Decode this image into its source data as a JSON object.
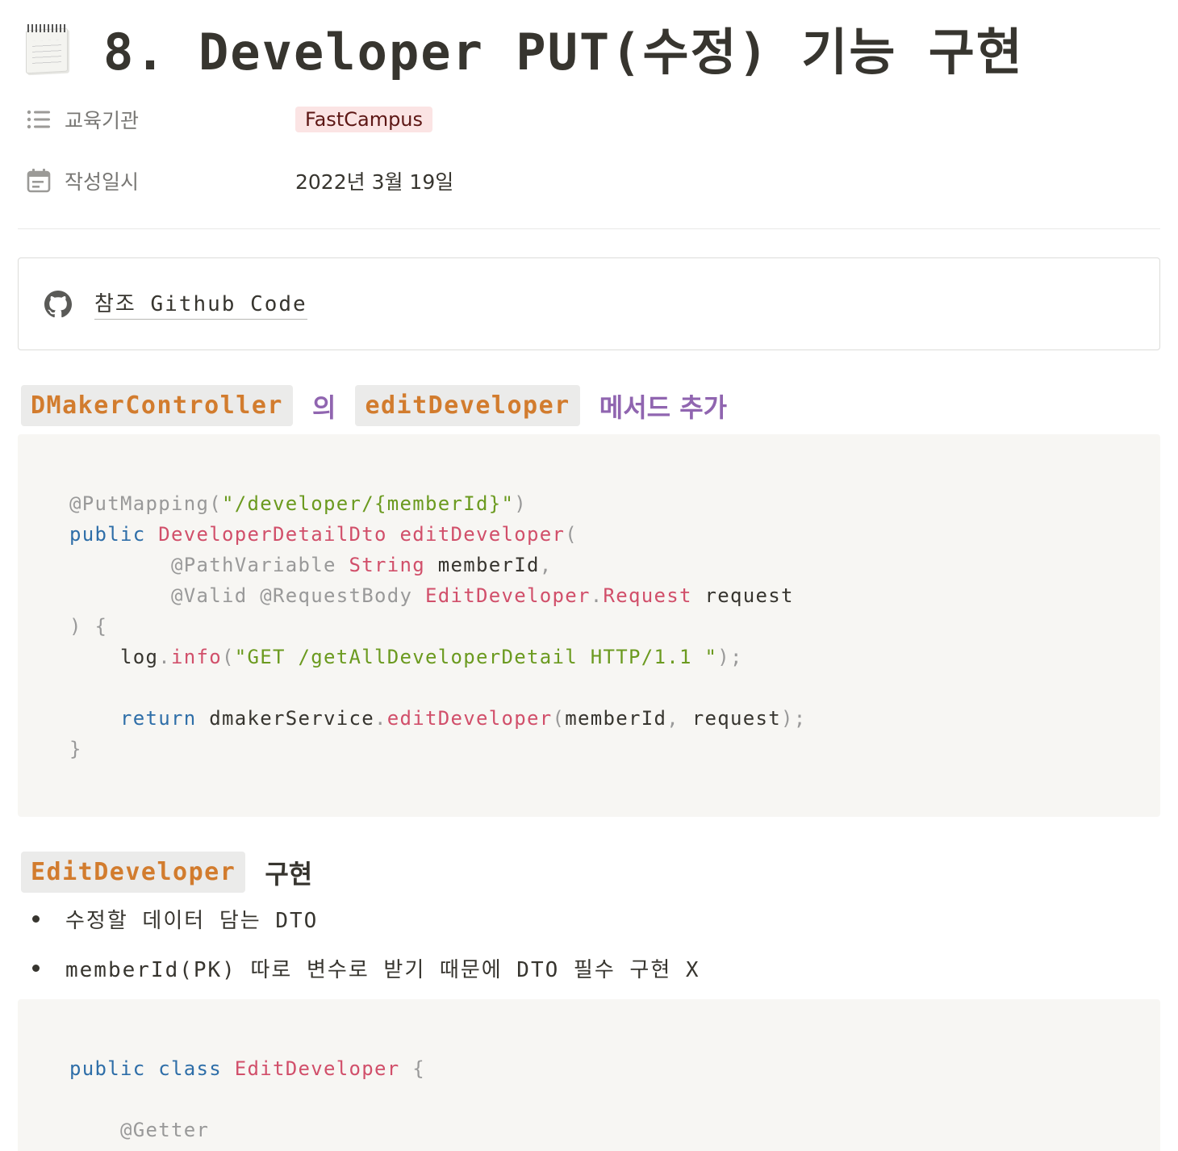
{
  "page": {
    "icon": "spiral-notepad-icon",
    "title": "8. Developer PUT(수정) 기능 구현"
  },
  "properties": [
    {
      "icon": "list-icon",
      "label": "교육기관",
      "value": "FastCampus",
      "tag_color": "#fbe4e4"
    },
    {
      "icon": "calendar-icon",
      "label": "작성일시",
      "value": "2022년 3월 19일"
    }
  ],
  "bookmark": {
    "icon": "github-icon",
    "label": "참조 Github Code"
  },
  "section1": {
    "chip1": "DMakerController",
    "word1": "의",
    "chip2": "editDeveloper",
    "word2": "메서드 추가"
  },
  "code1": {
    "l1": {
      "ann": "@PutMapping(",
      "str": "\"/developer/{memberId}\"",
      "close": ")"
    },
    "l2": {
      "kw": "public",
      "ty": "DeveloperDetailDto",
      "fn": "editDeveloper",
      "open": "("
    },
    "l3": {
      "ann": "@PathVariable",
      "ty": "String",
      "id": "memberId",
      "comma": ","
    },
    "l4": {
      "ann": "@Valid @RequestBody",
      "ty": "EditDeveloper",
      "dot": ".",
      "ty2": "Request",
      "id": "request"
    },
    "l5": {
      "text": ") {"
    },
    "l6": {
      "id": "log",
      "dot": ".",
      "fn": "info",
      "open": "(",
      "str": "\"GET /getAllDeveloperDetail HTTP/1.1 \"",
      "close": ");"
    },
    "l8": {
      "kw": "return",
      "id": "dmakerService",
      "dot": ".",
      "fn": "editDeveloper",
      "open": "(",
      "arg1": "memberId",
      "comma": ",",
      "arg2": "request",
      "close": ");"
    },
    "l9": {
      "text": "}"
    }
  },
  "section2": {
    "chip": "EditDeveloper",
    "word": "구현"
  },
  "bullets": [
    "수정할 데이터 담는 DTO",
    "memberId(PK) 따로 변수로 받기 때문에 DTO 필수 구현 X"
  ],
  "code2": {
    "l1": {
      "kw": "public class",
      "ty": "EditDeveloper",
      "brace": "{"
    },
    "l3": {
      "ann": "@Getter"
    }
  }
}
